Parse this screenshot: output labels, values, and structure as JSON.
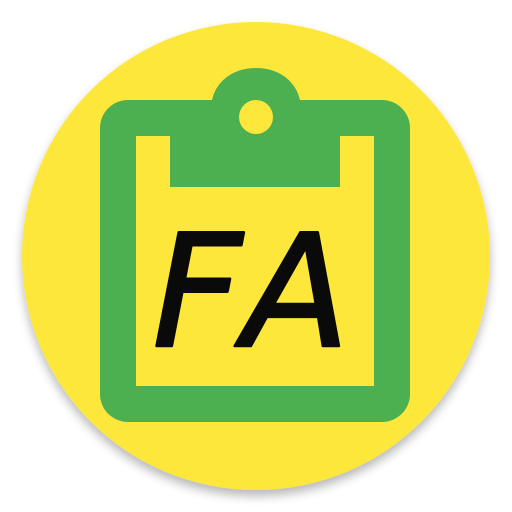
{
  "icon": {
    "name": "clipboard-icon",
    "label": "FA",
    "colors": {
      "background_circle": "#FDE73A",
      "clipboard": "#4CAF50",
      "clipboard_fill": "#FDE73A",
      "text": "#0A0A0A",
      "hole": "#FDE73A"
    }
  }
}
